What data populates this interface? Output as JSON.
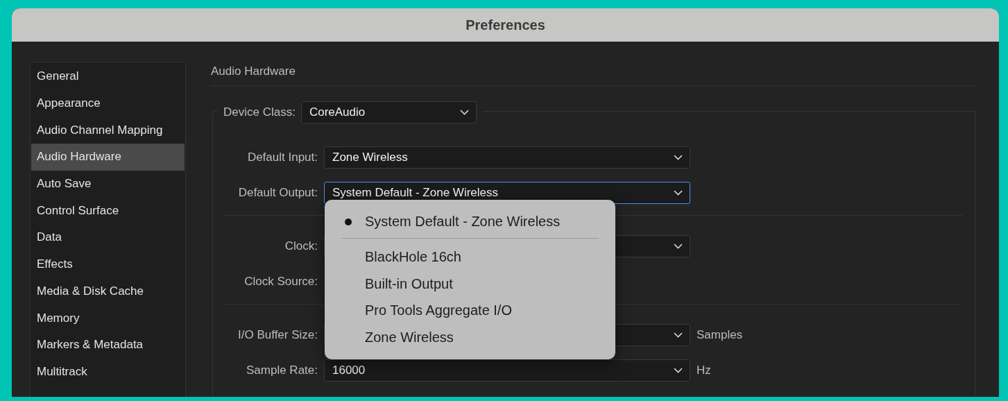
{
  "window": {
    "title": "Preferences"
  },
  "sidebar": {
    "items": [
      {
        "label": "General",
        "selected": false
      },
      {
        "label": "Appearance",
        "selected": false
      },
      {
        "label": "Audio Channel Mapping",
        "selected": false
      },
      {
        "label": "Audio Hardware",
        "selected": true
      },
      {
        "label": "Auto Save",
        "selected": false
      },
      {
        "label": "Control Surface",
        "selected": false
      },
      {
        "label": "Data",
        "selected": false
      },
      {
        "label": "Effects",
        "selected": false
      },
      {
        "label": "Media & Disk Cache",
        "selected": false
      },
      {
        "label": "Memory",
        "selected": false
      },
      {
        "label": "Markers & Metadata",
        "selected": false
      },
      {
        "label": "Multitrack",
        "selected": false
      }
    ]
  },
  "panel": {
    "heading": "Audio Hardware",
    "device_class": {
      "label": "Device Class:",
      "value": "CoreAudio"
    },
    "sections": [
      [
        {
          "kind": "select",
          "label": "Default Input:",
          "value": "Zone Wireless",
          "focused": false
        },
        {
          "kind": "select",
          "label": "Default Output:",
          "value": "System Default - Zone Wireless",
          "focused": true,
          "menu": {
            "groups": [
              [
                {
                  "label": "System Default - Zone Wireless",
                  "selected": true
                }
              ],
              [
                {
                  "label": "BlackHole 16ch",
                  "selected": false
                },
                {
                  "label": "Built-in Output",
                  "selected": false
                },
                {
                  "label": "Pro Tools Aggregate I/O",
                  "selected": false
                },
                {
                  "label": "Zone Wireless",
                  "selected": false
                }
              ]
            ]
          }
        }
      ],
      [
        {
          "kind": "select",
          "label": "Clock:",
          "focused": false
        },
        {
          "kind": "label",
          "label": "Clock Source:"
        }
      ],
      [
        {
          "kind": "select",
          "label": "I/O Buffer Size:",
          "focused": false,
          "unit": "Samples"
        },
        {
          "kind": "select",
          "label": "Sample Rate:",
          "value": "16000",
          "focused": false,
          "unit": "Hz"
        }
      ]
    ]
  }
}
